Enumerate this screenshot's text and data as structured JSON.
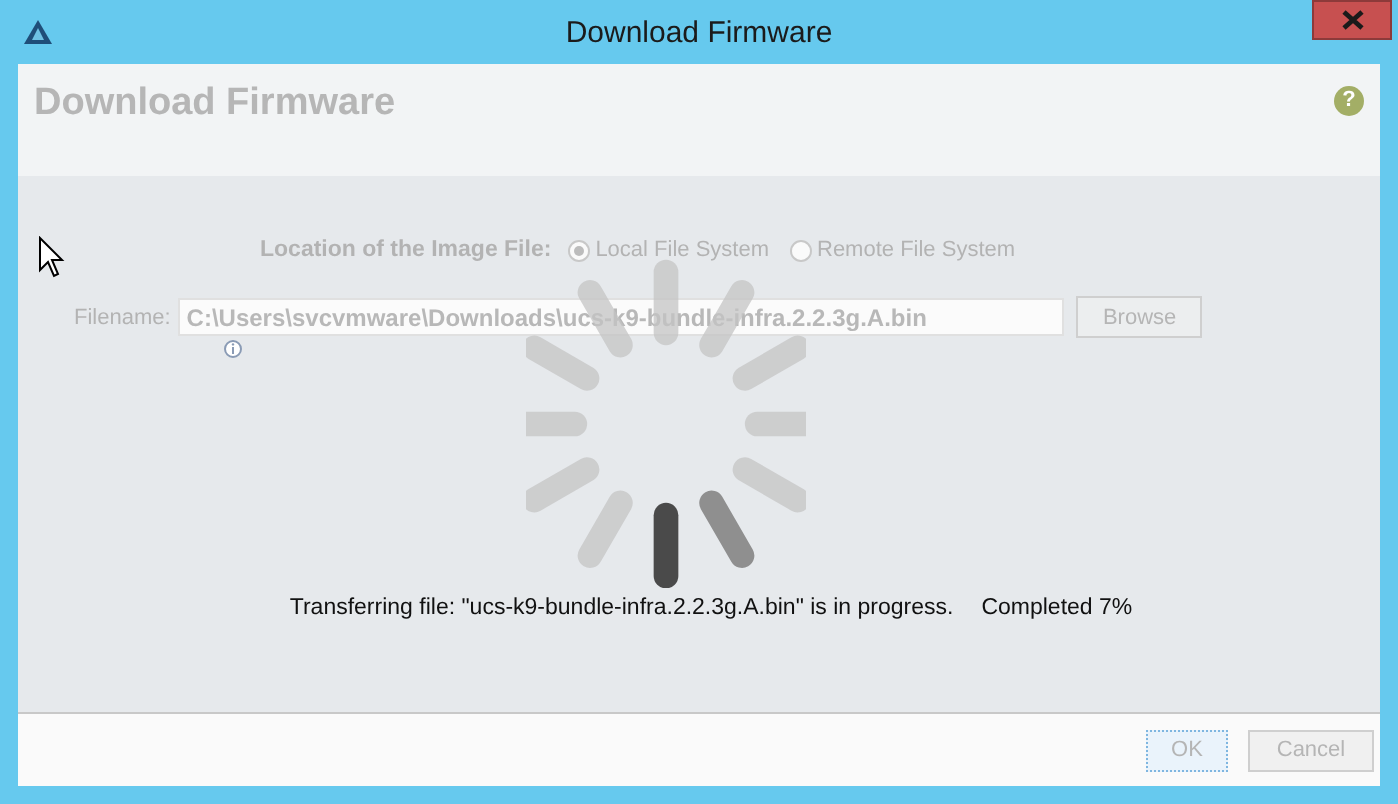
{
  "window": {
    "title": "Download Firmware"
  },
  "header": {
    "title": "Download Firmware",
    "help": "?"
  },
  "form": {
    "disabled": true,
    "location_label": "Location of the Image File:",
    "options": [
      {
        "label": "Local File System",
        "selected": true
      },
      {
        "label": "Remote File System",
        "selected": false
      }
    ],
    "filename_label": "Filename:",
    "filename": "C:\\Users\\svcvmware\\Downloads\\ucs-k9-bundle-infra.2.2.3g.A.bin",
    "browse": "Browse"
  },
  "status": {
    "message": "Transferring file: \"ucs-k9-bundle-infra.2.2.3g.A.bin\" is in progress.",
    "progress": "Completed 7%"
  },
  "buttons": [
    {
      "label": "OK",
      "disabled": true,
      "focused": true
    },
    {
      "label": "Cancel",
      "disabled": true,
      "focused": false
    }
  ]
}
